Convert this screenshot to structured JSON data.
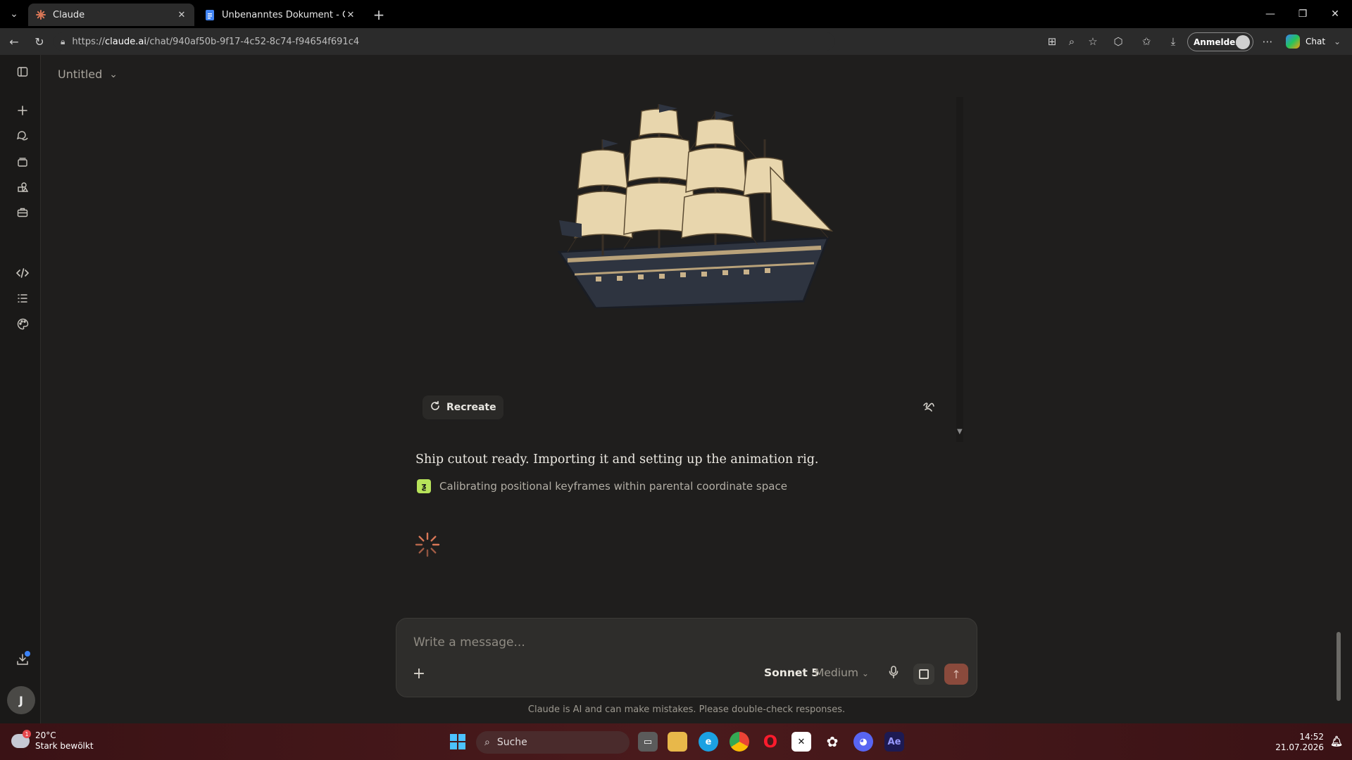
{
  "browser": {
    "tabs": [
      {
        "label": "Claude",
        "active": true
      },
      {
        "label": "Unbenanntes Dokument - Google",
        "active": false
      }
    ],
    "url_prefix": "https://",
    "url_host": "claude.ai",
    "url_path": "/chat/940af50b-9f17-4c52-8c74-f94654f691c4",
    "signin_label": "Anmelden",
    "copilot_label": "Chat"
  },
  "app": {
    "doc_title": "Untitled",
    "avatar_initial": "J",
    "artifact": {
      "recreate_label": "Recreate"
    },
    "message": "Ship cutout ready. Importing it and setting up the animation rig.",
    "status": "Calibrating positional keyframes within parental coordinate space",
    "composer": {
      "placeholder": "Write a message...",
      "model": "Sonnet 5",
      "effort": "Medium"
    },
    "disclaimer": "Claude is AI and can make mistakes. Please double-check responses."
  },
  "taskbar": {
    "weather_temp": "20°C",
    "weather_desc": "Stark bewölkt",
    "weather_badge": "1",
    "search_label": "Suche",
    "time": "14:52",
    "date": "21.07.2026"
  },
  "colors": {
    "app_bg": "#1f1e1d",
    "accent_send": "#8a4a3c",
    "status_icon": "#b7e35a",
    "spinner": "#d97757"
  }
}
